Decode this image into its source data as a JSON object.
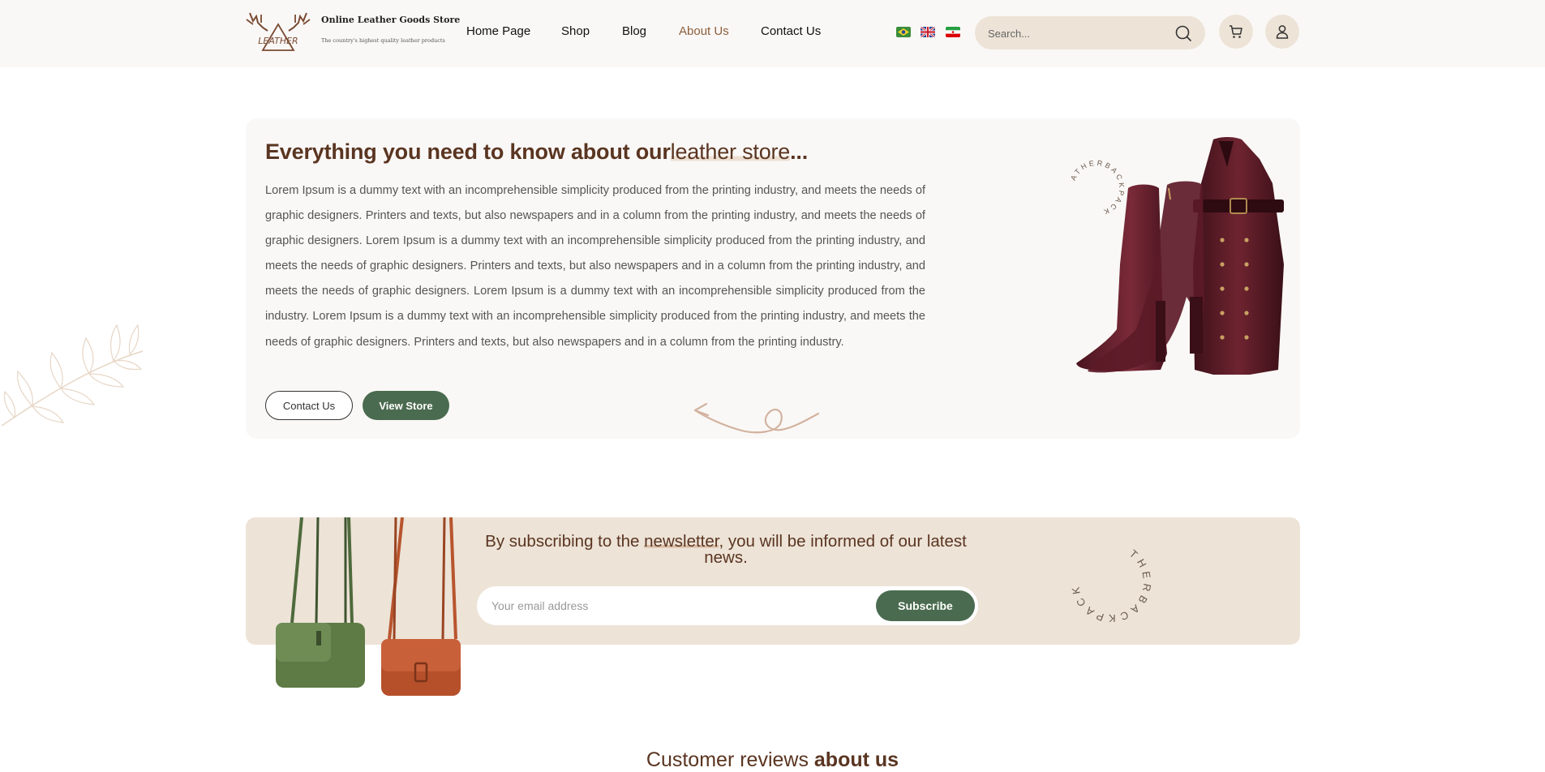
{
  "header": {
    "brand": {
      "logo_text": "LEATHER",
      "title": "Online Leather Goods Store",
      "subtitle": "The country's highest quality leather products"
    },
    "nav": [
      {
        "label": "Home Page",
        "active": false
      },
      {
        "label": "Shop",
        "active": false
      },
      {
        "label": "Blog",
        "active": false
      },
      {
        "label": "About Us",
        "active": true
      },
      {
        "label": "Contact Us",
        "active": false
      }
    ],
    "flags": [
      "brazil-flag-icon",
      "uk-flag-icon",
      "iran-flag-icon"
    ],
    "search": {
      "placeholder": "Search...",
      "icon": "search-icon"
    },
    "cart_icon": "cart-icon",
    "user_icon": "user-icon"
  },
  "hero": {
    "title_prefix": "Everything you need to know about our",
    "title_highlight": "leather store",
    "title_suffix": "...",
    "body": "Lorem Ipsum is a dummy text with an incomprehensible simplicity produced from the printing industry, and meets the needs of graphic designers. Printers and texts, but also newspapers and in a column from the printing industry, and meets the needs of graphic designers. Lorem Ipsum is a dummy text with an incomprehensible simplicity produced from the printing industry, and meets the needs of graphic designers. Printers and texts, but also newspapers and in a column from the printing industry, and meets the needs of graphic designers. Lorem Ipsum is a dummy text with an incomprehensible simplicity produced from the industry. Lorem Ipsum is a dummy text with an incomprehensible simplicity produced from the printing industry, and meets the needs of graphic designers. Printers and texts, but also newspapers and in a column from the printing industry.",
    "contact_button": "Contact Us",
    "store_button": "View Store",
    "badge_text": "ATHERBACKPACK"
  },
  "newsletter": {
    "title_prefix": "By subscribing to the ",
    "title_highlight": "newsletter",
    "title_suffix": ", you will be informed of our latest news.",
    "email_placeholder": "Your email address",
    "subscribe_button": "Subscribe",
    "badge_text": "THERBACKPACK"
  },
  "reviews": {
    "title_regular": "Customer reviews ",
    "title_bold": "about us"
  },
  "colors": {
    "brown": "#5a3521",
    "accent_nav": "#8b5e3c",
    "green": "#4a6b4f",
    "beige": "#ede3d7",
    "light_bg": "#faf8f6"
  }
}
